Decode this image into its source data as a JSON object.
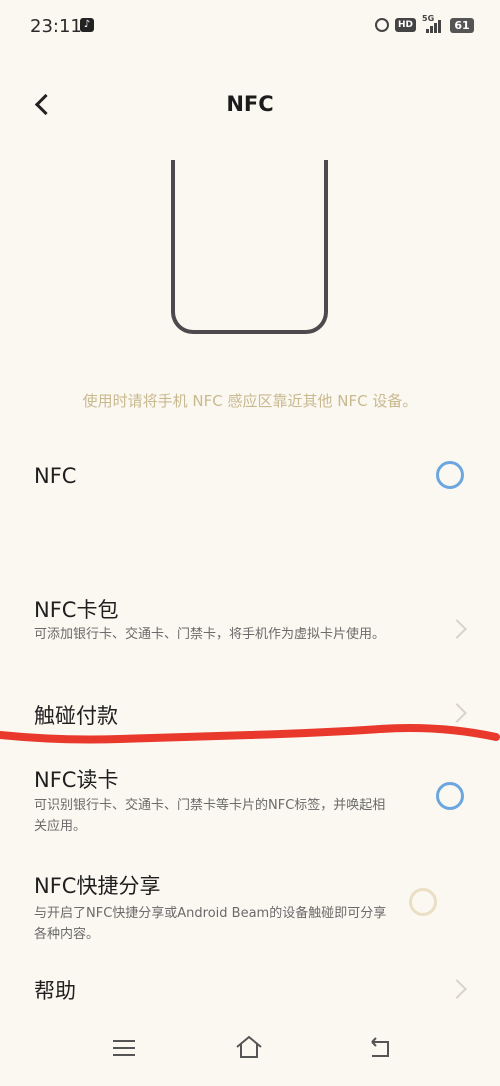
{
  "status": {
    "time": "23:11",
    "network": "5G",
    "battery": "61",
    "hd": "HD"
  },
  "header": {
    "title": "NFC"
  },
  "hint": "使用时请将手机 NFC 感应区靠近其他 NFC 设备。",
  "rows": {
    "nfc": {
      "title": "NFC",
      "toggle": "on"
    },
    "wallet": {
      "title": "NFC卡包",
      "desc": "可添加银行卡、交通卡、门禁卡，将手机作为虚拟卡片使用。"
    },
    "tap_pay": {
      "title": "触碰付款"
    },
    "reader": {
      "title": "NFC读卡",
      "desc": "可识别银行卡、交通卡、门禁卡等卡片的NFC标签，并唤起相关应用。",
      "toggle": "on"
    },
    "share": {
      "title": "NFC快捷分享",
      "desc": "与开启了NFC快捷分享或Android Beam的设备触碰即可分享各种内容。",
      "toggle": "off"
    },
    "help": {
      "title": "帮助"
    }
  },
  "colors": {
    "toggle_on": "#6ca6e0",
    "toggle_off": "#eadfc5",
    "hint": "#c9b98f",
    "annotation": "#e8392c"
  }
}
